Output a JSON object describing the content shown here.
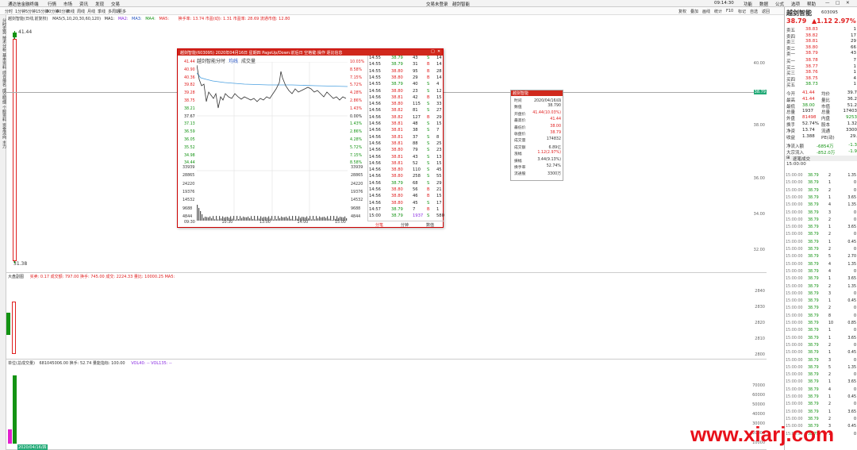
{
  "app": {
    "title": "通达信金融终端",
    "menu": [
      "行情",
      "市场",
      "资讯",
      "发现",
      "交易"
    ],
    "center_title": "交易未登录",
    "center_stock": "越剑智能",
    "time": "09:14:30",
    "right_menu": [
      "功能",
      "数据",
      "公式",
      "选项",
      "帮助"
    ]
  },
  "toolbar": {
    "periods": [
      "分时",
      "1分钟",
      "5分钟",
      "15分钟",
      "30分钟",
      "60分钟",
      "日线",
      "周线",
      "月线",
      "季线",
      "多周期",
      "更多"
    ],
    "right": [
      "复权",
      "叠加",
      "画线",
      "统计",
      "F10",
      "标记",
      "自选",
      "返回"
    ]
  },
  "left_nav": [
    "分时走势",
    "技术分析",
    "基本资料",
    "综合排名",
    "成交明细",
    "个股资料",
    "资金流向",
    "主力"
  ],
  "main_chart": {
    "title": "越剑智能(日线,前复权)",
    "ma_label": "MA5(5,10,20,30,60,120)",
    "ma_items": [
      "MA1:",
      "MA2:",
      "MA3:",
      "MA4:",
      "MA5:"
    ],
    "info": "换手率: 13.74 市盈(动): 1.31 市盈率: 28.69 流通市值: 12.80",
    "high": "41.44",
    "low": "31.38",
    "yaxis": [
      "40.00",
      "38.00",
      "36.00",
      "34.00",
      "32.00"
    ],
    "cur_price": "38.79"
  },
  "mid_chart": {
    "title": "大盘副图",
    "vals": "买卖: 0.17  成交额: 797.00  换手: 745.00  成交: 2224.33  量比: 10000.25 MA5:",
    "yaxis": [
      "2840",
      "2830",
      "2820",
      "2810",
      "2800"
    ]
  },
  "vol_chart": {
    "title": "单位(总成交量)",
    "vals": "681045006.00  换手: 52.74  量能指标: 100.00",
    "ma": "VOL40: -- VOL135: --",
    "yaxis": [
      "70000",
      "60000",
      "50000",
      "40000",
      "30000",
      "20000",
      "10000"
    ],
    "date": "2020/04/16/四"
  },
  "popup": {
    "header": "越剑智能(603095) 2020年04月16日 星期四 PageUp/Down:前后日 空格键:操作 逐比信息",
    "sub_title": "越剑智能",
    "sub_labels": [
      "分时",
      "均线",
      "成交量"
    ],
    "left_prices": [
      "41.44",
      "40.90",
      "40.36",
      "39.82",
      "39.28",
      "38.75",
      "38.21",
      "37.67",
      "37.13",
      "36.59",
      "36.05",
      "35.52",
      "34.98",
      "34.44"
    ],
    "right_pct": [
      "10.03%",
      "8.58%",
      "7.15%",
      "5.72%",
      "4.28%",
      "2.86%",
      "1.43%",
      "0.00%",
      "1.43%",
      "2.86%",
      "4.28%",
      "5.72%",
      "7.15%",
      "8.58%"
    ],
    "vol_axis": [
      "33939",
      "28865",
      "24220",
      "19376",
      "14532",
      "9688",
      "4844"
    ],
    "times": [
      "09:30",
      "10:30",
      "13:00",
      "14:00",
      "15:00"
    ],
    "ticks": [
      [
        "14:55",
        "38.79",
        "43",
        "S",
        "14"
      ],
      [
        "14:55",
        "38.79",
        "31",
        "B",
        "14"
      ],
      [
        "14:55",
        "38.80",
        "95",
        "B",
        "28"
      ],
      [
        "14:55",
        "38.80",
        "29",
        "B",
        "14"
      ],
      [
        "14:55",
        "38.79",
        "40",
        "S",
        "4"
      ],
      [
        "14:56",
        "38.80",
        "23",
        "S",
        "12"
      ],
      [
        "14:56",
        "38.81",
        "42",
        "B",
        "15"
      ],
      [
        "14:56",
        "38.80",
        "115",
        "S",
        "33"
      ],
      [
        "14:56",
        "38.82",
        "81",
        "S",
        "27"
      ],
      [
        "14:56",
        "38.82",
        "127",
        "B",
        "29"
      ],
      [
        "14:56",
        "38.81",
        "48",
        "S",
        "15"
      ],
      [
        "14:56",
        "38.81",
        "38",
        "S",
        "7"
      ],
      [
        "14:56",
        "38.81",
        "37",
        "S",
        "8"
      ],
      [
        "14:56",
        "38.81",
        "88",
        "S",
        "25"
      ],
      [
        "14:56",
        "38.80",
        "79",
        "S",
        "23"
      ],
      [
        "14:56",
        "38.81",
        "43",
        "S",
        "13"
      ],
      [
        "14:56",
        "38.81",
        "52",
        "S",
        "15"
      ],
      [
        "14:56",
        "38.80",
        "110",
        "S",
        "45"
      ],
      [
        "14:56",
        "38.80",
        "258",
        "S",
        "55"
      ],
      [
        "14:56",
        "38.79",
        "68",
        "S",
        "29"
      ],
      [
        "14:56",
        "38.80",
        "56",
        "B",
        "21"
      ],
      [
        "14:56",
        "38.80",
        "46",
        "B",
        "15"
      ],
      [
        "14:56",
        "38.80",
        "45",
        "S",
        "17"
      ],
      [
        "14:57",
        "38.79",
        "7",
        "B",
        "1"
      ],
      [
        "15:00",
        "38.79",
        "1937",
        "S",
        "580"
      ]
    ],
    "footer": [
      "分笔",
      "分钟",
      "数值"
    ]
  },
  "info_box": {
    "header": "越剑智能",
    "rows": [
      [
        "时间",
        "2020/04/16/四"
      ],
      [
        "数值",
        "38.790"
      ],
      [
        "开盘价",
        "41.44(10.03%)"
      ],
      [
        "最高价",
        "41.44"
      ],
      [
        "最低价",
        "38.00"
      ],
      [
        "收盘价",
        "38.79"
      ],
      [
        "成交量",
        "174832"
      ],
      [
        "成交额",
        "6.89亿"
      ],
      [
        "涨幅",
        "1.12(2.97%)"
      ],
      [
        "振幅",
        "3.44(9.13%)"
      ],
      [
        "换手率",
        "52.74%"
      ],
      [
        "流通股",
        "3300万"
      ]
    ]
  },
  "quote": {
    "name": "越剑智能",
    "code": "603095",
    "price": "38.79",
    "change": "▲1.12",
    "pct": "2.97%",
    "asks": [
      [
        "卖五",
        "38.83",
        "1"
      ],
      [
        "卖四",
        "38.82",
        "17"
      ],
      [
        "卖三",
        "38.81",
        "29"
      ],
      [
        "卖二",
        "38.80",
        "66"
      ],
      [
        "卖一",
        "38.79",
        "43"
      ]
    ],
    "bids": [
      [
        "买一",
        "38.78",
        "7"
      ],
      [
        "买二",
        "38.77",
        "1"
      ],
      [
        "买三",
        "38.76",
        "1"
      ],
      [
        "买四",
        "38.75",
        "4"
      ],
      [
        "买五",
        "38.73",
        "1"
      ]
    ],
    "stats": [
      [
        "今开",
        "41.44",
        "均价",
        "39.7"
      ],
      [
        "最高",
        "41.44",
        "量比",
        "36.2"
      ],
      [
        "最低",
        "38.00",
        "市值",
        "51.2"
      ],
      [
        "总量",
        "1937",
        "总量",
        "17403"
      ],
      [
        "外盘",
        "81498",
        "内盘",
        "9253"
      ],
      [
        "换手",
        "52.74%",
        "股本",
        "1.32"
      ],
      [
        "净资",
        "13.74",
        "流通",
        "3300"
      ],
      [
        "收益",
        "1.388",
        "PE(动)",
        "29."
      ]
    ],
    "flow": [
      [
        "净流入额",
        "-6854万",
        "-1.3"
      ],
      [
        "大宗流入",
        "-852.0万",
        "-1.9"
      ]
    ],
    "deal_title": "逐笔成交",
    "deal_time": "15:00:00",
    "deals": [
      [
        "38.79",
        "2",
        "1.35"
      ],
      [
        "38.79",
        "1",
        "0"
      ],
      [
        "38.79",
        "2",
        "0"
      ],
      [
        "38.79",
        "1",
        "3.65"
      ],
      [
        "38.79",
        "4",
        "1.35"
      ],
      [
        "38.79",
        "3",
        "0"
      ],
      [
        "38.79",
        "2",
        "0"
      ],
      [
        "38.79",
        "1",
        "3.65"
      ],
      [
        "38.79",
        "2",
        "0"
      ],
      [
        "38.79",
        "1",
        "0.45"
      ],
      [
        "38.79",
        "2",
        "0"
      ],
      [
        "38.79",
        "5",
        "2.70"
      ],
      [
        "38.79",
        "4",
        "1.35"
      ],
      [
        "38.79",
        "4",
        "0"
      ],
      [
        "38.79",
        "1",
        "3.65"
      ],
      [
        "38.79",
        "2",
        "1.35"
      ],
      [
        "38.79",
        "3",
        "0"
      ],
      [
        "38.79",
        "1",
        "0.45"
      ],
      [
        "38.79",
        "2",
        "0"
      ],
      [
        "38.79",
        "8",
        "0"
      ],
      [
        "38.79",
        "10",
        "0.85"
      ],
      [
        "38.79",
        "1",
        "0"
      ],
      [
        "38.79",
        "1",
        "3.65"
      ],
      [
        "38.79",
        "2",
        "0"
      ],
      [
        "38.79",
        "1",
        "0.45"
      ],
      [
        "38.79",
        "3",
        "0"
      ],
      [
        "38.79",
        "5",
        "1.35"
      ],
      [
        "38.79",
        "2",
        "0"
      ],
      [
        "38.79",
        "1",
        "3.65"
      ],
      [
        "38.79",
        "4",
        "0"
      ],
      [
        "38.79",
        "1",
        "0.45"
      ],
      [
        "38.79",
        "2",
        "0"
      ],
      [
        "38.79",
        "1",
        "3.65"
      ],
      [
        "38.79",
        "2",
        "0"
      ],
      [
        "38.79",
        "3",
        "0.45"
      ],
      [
        "38.79",
        "1",
        "0"
      ]
    ]
  },
  "watermark": "www.xiarj.com"
}
